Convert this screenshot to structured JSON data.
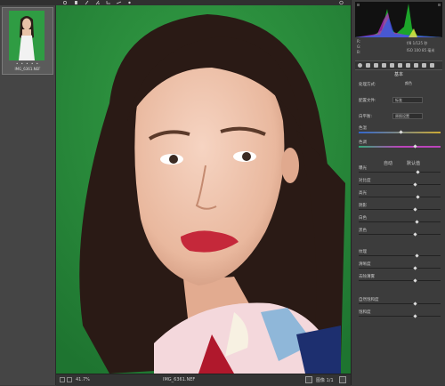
{
  "toolbar": {
    "tools": [
      "zoom-icon",
      "hand-icon",
      "white-balance-icon",
      "color-sampler-icon",
      "crop-icon",
      "straighten-icon",
      "spot-removal-icon",
      "rotate-icon"
    ]
  },
  "filmstrip": {
    "stars": "• • • • •",
    "file_name": "IMG_6361.NEF"
  },
  "status": {
    "zoom": "41.7%",
    "file_name": "IMG_6361.NEF",
    "image_count": "图像 1/1"
  },
  "readout": {
    "r": "R:",
    "g": "G:",
    "b": "B:",
    "exif1": "f/8  1/125 秒",
    "exif2": "ISO 100  85 毫米"
  },
  "panel": {
    "title": "基本",
    "treatment_label": "处理方式:",
    "treatment_value": "颜色",
    "profile_label": "配置文件:",
    "profile_value": "标准",
    "wb_label": "白平衡:",
    "wb_value": "原照设置",
    "tone_auto": "自动",
    "tone_default": "默认值",
    "sliders": [
      {
        "label": "色温",
        "value": ""
      },
      {
        "label": "色调",
        "value": ""
      },
      {
        "label": "曝光",
        "value": ""
      },
      {
        "label": "对比度",
        "value": ""
      },
      {
        "label": "高光",
        "value": ""
      },
      {
        "label": "阴影",
        "value": ""
      },
      {
        "label": "白色",
        "value": ""
      },
      {
        "label": "黑色",
        "value": ""
      },
      {
        "label": "纹理",
        "value": ""
      },
      {
        "label": "清晰度",
        "value": ""
      },
      {
        "label": "去除薄雾",
        "value": ""
      },
      {
        "label": "自然饱和度",
        "value": ""
      },
      {
        "label": "饱和度",
        "value": ""
      }
    ]
  },
  "colors": {
    "backdrop": "#2a8a3a",
    "panel": "#3c3c3c",
    "accent": "#2f9c43"
  }
}
